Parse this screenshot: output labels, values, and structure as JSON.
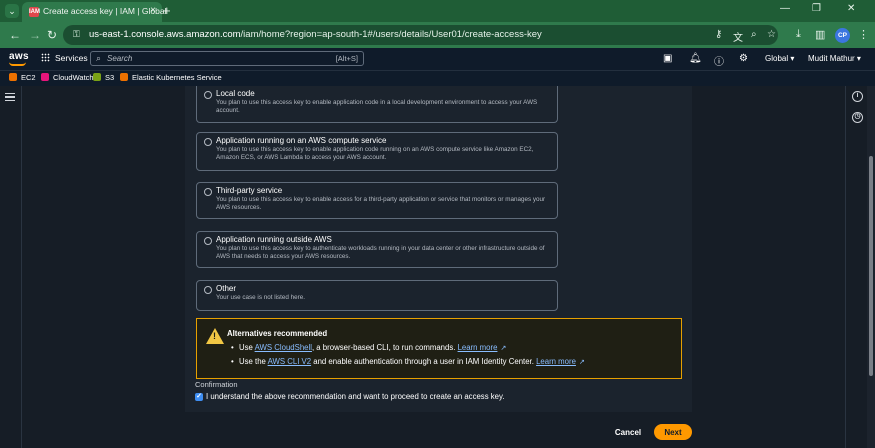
{
  "browser": {
    "tab_title": "Create access key | IAM | Global",
    "tab_favicon_text": "IAM",
    "url_host": "us-east-1.console.aws.amazon.com",
    "url_path": "/iam/home?region=ap-south-1#/users/details/User01/create-access-key",
    "profile_initials": "CP"
  },
  "aws_header": {
    "logo": "aws",
    "services_label": "Services",
    "search_placeholder": "Search",
    "search_shortcut": "[Alt+S]",
    "region": "Global ▾",
    "user": "Mudit Mathur ▾"
  },
  "favorites": [
    {
      "label": "EC2",
      "color": "#ed7100"
    },
    {
      "label": "CloudWatch",
      "color": "#e7157b"
    },
    {
      "label": "S3",
      "color": "#7aa116"
    },
    {
      "label": "Elastic Kubernetes Service",
      "color": "#ed7100"
    }
  ],
  "options": [
    {
      "title": "Local code",
      "desc": "You plan to use this access key to enable application code in a local development environment to access your AWS account."
    },
    {
      "title": "Application running on an AWS compute service",
      "desc": "You plan to use this access key to enable application code running on an AWS compute service like Amazon EC2, Amazon ECS, or AWS Lambda to access your AWS account."
    },
    {
      "title": "Third-party service",
      "desc": "You plan to use this access key to enable access for a third-party application or service that monitors or manages your AWS resources."
    },
    {
      "title": "Application running outside AWS",
      "desc": "You plan to use this access key to authenticate workloads running in your data center or other infrastructure outside of AWS that needs to access your AWS resources."
    },
    {
      "title": "Other",
      "desc": "Your use case is not listed here."
    }
  ],
  "alert": {
    "title": "Alternatives recommended",
    "b1_pre": "Use ",
    "b1_link": "AWS CloudShell",
    "b1_mid": ", a browser-based CLI, to run commands. ",
    "b1_learn": "Learn more",
    "b2_pre": "Use the ",
    "b2_link": "AWS CLI V2",
    "b2_mid": " and enable authentication through a user in IAM Identity Center. ",
    "b2_learn": "Learn more"
  },
  "confirmation": {
    "label": "Confirmation",
    "checkbox_text": "I understand the above recommendation and want to proceed to create an access key.",
    "checked": true
  },
  "actions": {
    "cancel": "Cancel",
    "next": "Next"
  }
}
